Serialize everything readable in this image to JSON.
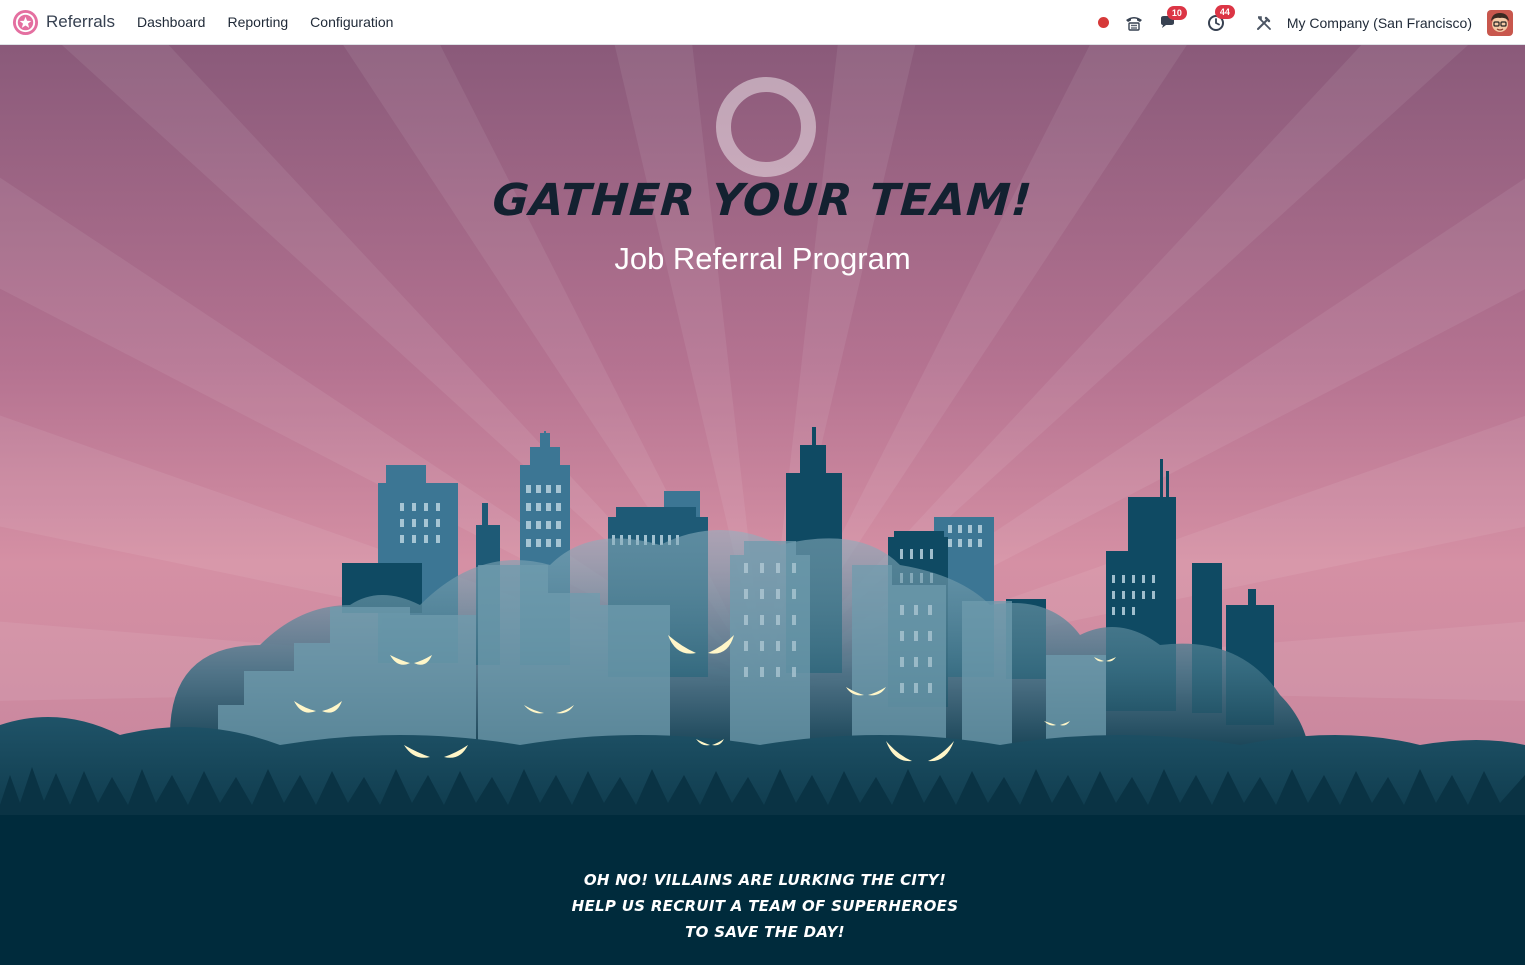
{
  "navbar": {
    "app_name": "Referrals",
    "menu": [
      {
        "label": "Dashboard"
      },
      {
        "label": "Reporting"
      },
      {
        "label": "Configuration"
      }
    ],
    "messages_count": "10",
    "activities_count": "44",
    "company": "My Company (San Francisco)"
  },
  "hero": {
    "headline": "GATHER YOUR TEAM!",
    "subtitle": "Job Referral Program",
    "tagline": "OH NO! VILLAINS ARE LURKING THE CITY! HELP US RECRUIT A TEAM OF SUPERHEROES TO SAVE THE DAY!"
  },
  "colors": {
    "sky_top": "#8a5a7a",
    "sky_horizon": "#d79aa6",
    "ground": "#002b3c",
    "badge": "#dc3545",
    "eyes": "#fff6c8"
  },
  "icons": [
    "referrals-logo-icon",
    "recording-dot-icon",
    "phone-icon",
    "chat-icon",
    "activity-clock-icon",
    "tools-icon",
    "user-avatar-icon"
  ]
}
